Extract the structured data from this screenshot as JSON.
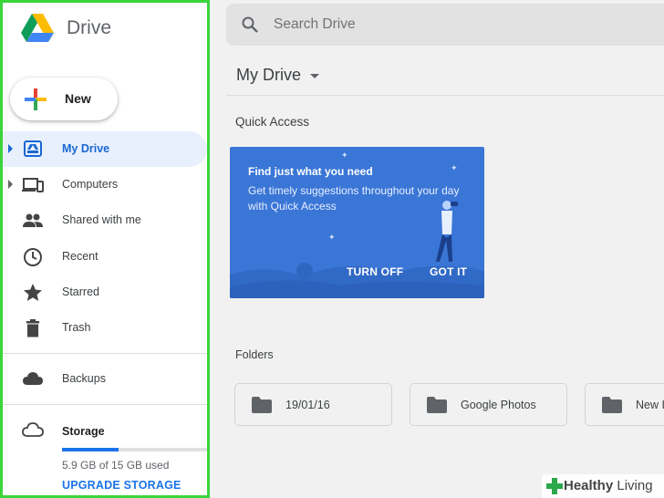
{
  "app": {
    "title": "Drive"
  },
  "new_button": {
    "label": "New"
  },
  "sidebar": {
    "items": [
      {
        "label": "My Drive",
        "icon": "my-drive-icon",
        "active": true,
        "expandable": true
      },
      {
        "label": "Computers",
        "icon": "computers-icon",
        "active": false,
        "expandable": true
      },
      {
        "label": "Shared with me",
        "icon": "shared-icon",
        "active": false,
        "expandable": false
      },
      {
        "label": "Recent",
        "icon": "clock-icon",
        "active": false,
        "expandable": false
      },
      {
        "label": "Starred",
        "icon": "star-icon",
        "active": false,
        "expandable": false
      },
      {
        "label": "Trash",
        "icon": "trash-icon",
        "active": false,
        "expandable": false
      }
    ],
    "backups": {
      "label": "Backups",
      "icon": "cloud-icon"
    },
    "storage": {
      "title": "Storage",
      "icon": "cloud-outline-icon",
      "used_text": "5.9 GB of 15 GB used",
      "used_fraction": 0.39,
      "upgrade_label": "UPGRADE STORAGE"
    }
  },
  "search": {
    "placeholder": "Search Drive"
  },
  "main": {
    "title": "My Drive",
    "quick_access": {
      "heading": "Quick Access",
      "card_title": "Find just what you need",
      "card_text": "Get timely suggestions throughout your day with Quick Access",
      "turn_off_label": "TURN OFF",
      "got_it_label": "GOT IT"
    },
    "folders": {
      "heading": "Folders",
      "items": [
        {
          "name": "19/01/16"
        },
        {
          "name": "Google Photos"
        },
        {
          "name": "New I"
        }
      ]
    }
  },
  "watermark": {
    "brand_a": "Healthy",
    "brand_b": " Living"
  },
  "colors": {
    "accent": "#1a73e8",
    "active_bg": "#e8f0fe",
    "card_bg": "#3a76d6",
    "sidebar_border": "#3bd43b"
  }
}
